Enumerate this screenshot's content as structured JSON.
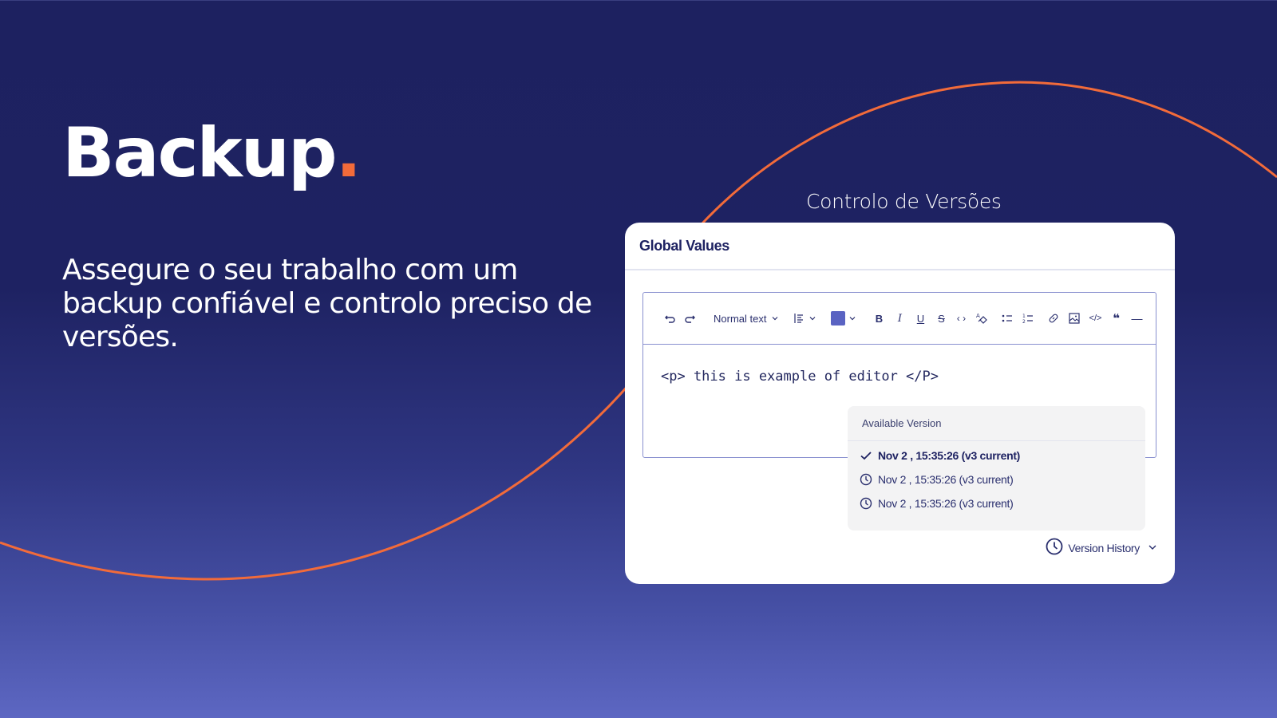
{
  "colors": {
    "background_top": "#1d2160",
    "background_bottom": "#5d67c2",
    "accent_orange": "#f26b3a",
    "card_bg": "#ffffff",
    "text_dark": "#1e2262",
    "swatch": "#5a63c2"
  },
  "hero": {
    "title": "Backup",
    "title_dot": ".",
    "subtitle": "Assegure o seu trabalho com um backup confiável e controlo preciso de versões."
  },
  "panel": {
    "caption": "Controlo de Versões",
    "card_title": "Global Values",
    "toolbar": {
      "undo": "undo-icon",
      "redo": "redo-icon",
      "text_style": "Normal text",
      "align": "align-icon",
      "color": "text-color-icon",
      "bold": "B",
      "italic": "I",
      "underline": "U",
      "strikethrough": "S",
      "code_inline": "‹ ›",
      "clear_format": "clear-format-icon",
      "bullet_list": "bullet-list-icon",
      "numbered_list": "numbered-list-icon",
      "link": "link-icon",
      "image": "image-icon",
      "code_block": "</>",
      "quote": "❝",
      "divider": "—"
    },
    "editor_content": "<p> this is example of editor </P>",
    "versions": {
      "title": "Available Version",
      "items": [
        {
          "label": "Nov 2 , 15:35:26 (v3 current)",
          "icon": "check-icon",
          "selected": true
        },
        {
          "label": "Nov 2 , 15:35:26 (v3 current)",
          "icon": "clock-icon",
          "selected": false
        },
        {
          "label": "Nov 2 , 15:35:26 (v3 current)",
          "icon": "clock-icon",
          "selected": false
        }
      ]
    },
    "history_button": "Version History"
  }
}
